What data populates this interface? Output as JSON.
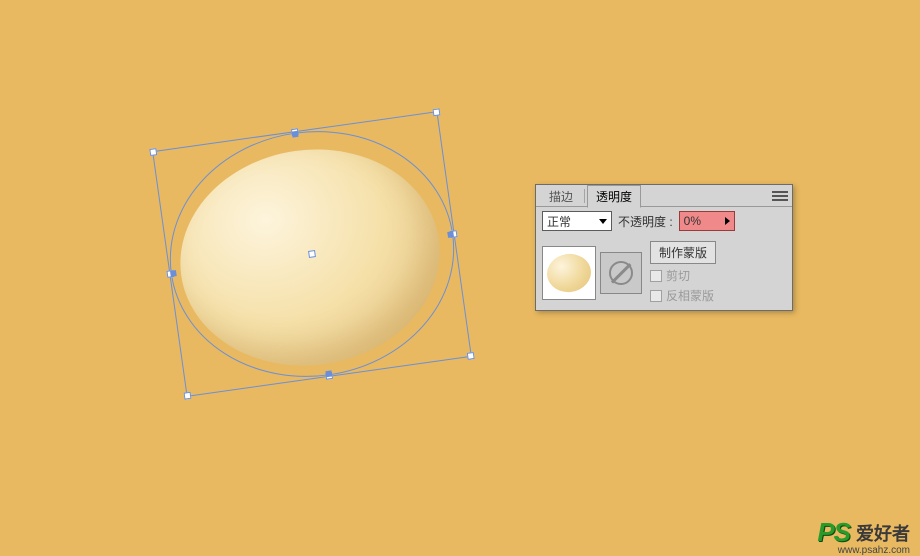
{
  "panel": {
    "tabs": {
      "stroke": "描边",
      "transparency": "透明度"
    },
    "blend_mode": "正常",
    "opacity_label": "不透明度 :",
    "opacity_value": "0%",
    "make_mask_label": "制作蒙版",
    "clip_label": "剪切",
    "invert_label": "反相蒙版"
  },
  "watermark": {
    "logo": "PS",
    "text": "爱好者",
    "url": "www.psahz.com"
  }
}
